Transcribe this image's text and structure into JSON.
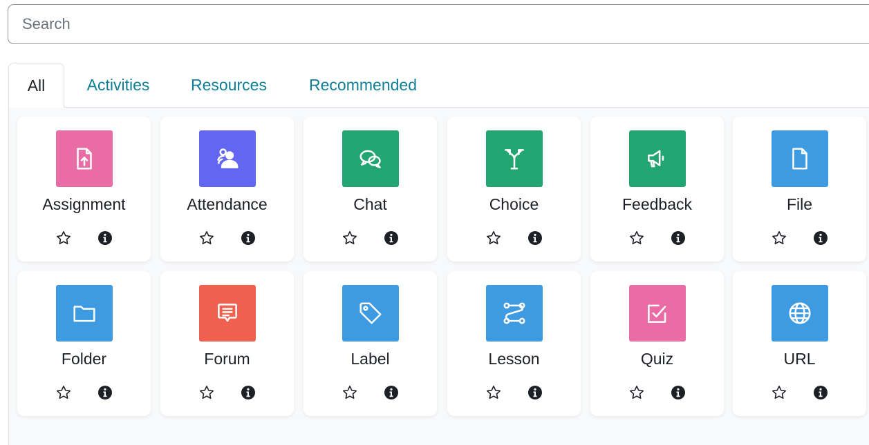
{
  "search": {
    "placeholder": "Search",
    "value": ""
  },
  "tabs": [
    {
      "label": "All",
      "active": true
    },
    {
      "label": "Activities",
      "active": false
    },
    {
      "label": "Resources",
      "active": false
    },
    {
      "label": "Recommended",
      "active": false
    }
  ],
  "colors": {
    "pink": "#e96ca6",
    "indigo": "#6366f1",
    "green": "#23a572",
    "blue": "#3e9be2",
    "red": "#f0604e",
    "link": "#0f7f96"
  },
  "modules": [
    {
      "label": "Assignment",
      "icon": "assignment-icon",
      "color": "#e96ca6"
    },
    {
      "label": "Attendance",
      "icon": "attendance-icon",
      "color": "#6366f1"
    },
    {
      "label": "Chat",
      "icon": "chat-icon",
      "color": "#23a572"
    },
    {
      "label": "Choice",
      "icon": "choice-icon",
      "color": "#23a572"
    },
    {
      "label": "Feedback",
      "icon": "feedback-icon",
      "color": "#23a572"
    },
    {
      "label": "File",
      "icon": "file-icon",
      "color": "#3e9be2"
    },
    {
      "label": "Folder",
      "icon": "folder-icon",
      "color": "#3e9be2"
    },
    {
      "label": "Forum",
      "icon": "forum-icon",
      "color": "#f0604e"
    },
    {
      "label": "Label",
      "icon": "label-icon",
      "color": "#3e9be2"
    },
    {
      "label": "Lesson",
      "icon": "lesson-icon",
      "color": "#3e9be2"
    },
    {
      "label": "Quiz",
      "icon": "quiz-icon",
      "color": "#e96ca6"
    },
    {
      "label": "URL",
      "icon": "url-icon",
      "color": "#3e9be2"
    }
  ],
  "card_actions": {
    "star_icon": "star-outline-icon",
    "info_icon": "info-circle-icon"
  }
}
